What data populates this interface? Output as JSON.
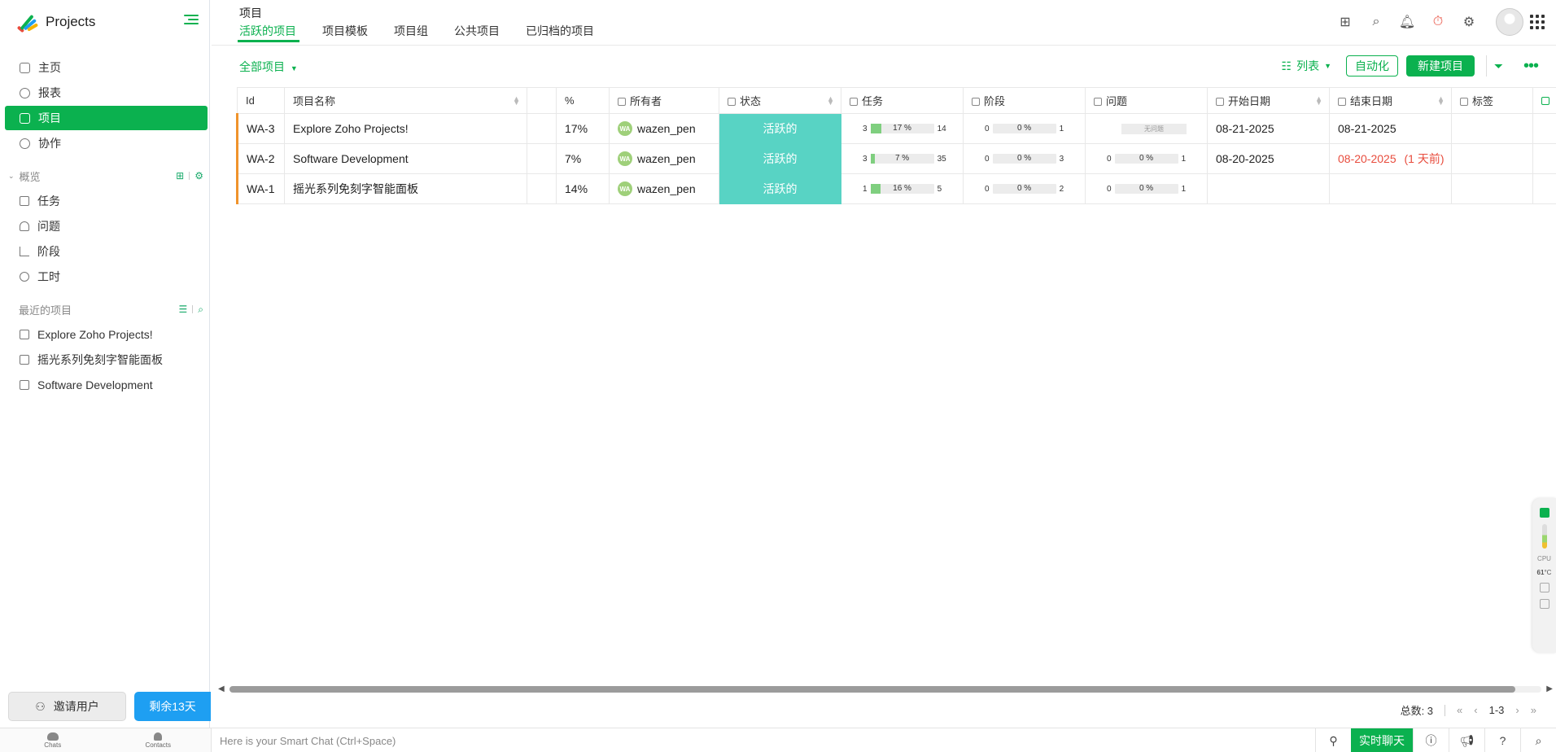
{
  "app": {
    "name": "Projects"
  },
  "sidebar": {
    "nav": [
      {
        "label": "主页",
        "icon": "home-icon"
      },
      {
        "label": "报表",
        "icon": "reports-icon"
      },
      {
        "label": "项目",
        "icon": "projects-icon",
        "active": true
      },
      {
        "label": "协作",
        "icon": "collaboration-icon"
      }
    ],
    "overview": {
      "title": "概览",
      "items": [
        {
          "label": "任务",
          "icon": "task-icon"
        },
        {
          "label": "问题",
          "icon": "issue-icon"
        },
        {
          "label": "阶段",
          "icon": "milestone-icon"
        },
        {
          "label": "工时",
          "icon": "timesheet-icon"
        }
      ]
    },
    "recent": {
      "title": "最近的项目",
      "items": [
        "Explore Zoho Projects!",
        "摇光系列免刻字智能面板",
        "Software Development"
      ]
    },
    "invite_label": "邀请用户",
    "trial_label": "剩余13天",
    "bottom": {
      "chats": "Chats",
      "contacts": "Contacts"
    }
  },
  "topbar": {
    "title": "项目",
    "tabs": [
      "活跃的项目",
      "项目模板",
      "项目组",
      "公共项目",
      "已归档的项目"
    ],
    "active_tab": 0
  },
  "toolbar": {
    "filter_label": "全部项目",
    "view_label": "列表",
    "automation_label": "自动化",
    "new_project_label": "新建项目"
  },
  "table": {
    "headers": {
      "id": "Id",
      "name": "项目名称",
      "percent": "%",
      "owner": "所有者",
      "status": "状态",
      "tasks": "任务",
      "milestones": "阶段",
      "issues": "问题",
      "start": "开始日期",
      "end": "结束日期",
      "tags": "标签"
    },
    "rows": [
      {
        "id": "WA-3",
        "name": "Explore Zoho Projects!",
        "percent": "17%",
        "owner": "wazen_pen",
        "owner_initials": "WA",
        "status": "活跃的",
        "tasks": {
          "open": "3",
          "pct_label": "17 %",
          "pct": 17,
          "closed": "14"
        },
        "milestones": {
          "open": "0",
          "pct_label": "0 %",
          "pct": 0,
          "closed": "1"
        },
        "issues": {
          "none": "无问题"
        },
        "start": "08-21-2025",
        "end": "08-21-2025",
        "end_note": ""
      },
      {
        "id": "WA-2",
        "name": "Software Development",
        "percent": "7%",
        "owner": "wazen_pen",
        "owner_initials": "WA",
        "status": "活跃的",
        "tasks": {
          "open": "3",
          "pct_label": "7 %",
          "pct": 7,
          "closed": "35"
        },
        "milestones": {
          "open": "0",
          "pct_label": "0 %",
          "pct": 0,
          "closed": "3"
        },
        "issues": {
          "open": "0",
          "pct_label": "0 %",
          "pct": 0,
          "closed": "1"
        },
        "start": "08-20-2025",
        "end": "08-20-2025",
        "end_note": "(1 天前)"
      },
      {
        "id": "WA-1",
        "name": "摇光系列免刻字智能面板",
        "percent": "14%",
        "owner": "wazen_pen",
        "owner_initials": "WA",
        "status": "活跃的",
        "tasks": {
          "open": "1",
          "pct_label": "16 %",
          "pct": 16,
          "closed": "5"
        },
        "milestones": {
          "open": "0",
          "pct_label": "0 %",
          "pct": 0,
          "closed": "2"
        },
        "issues": {
          "open": "0",
          "pct_label": "0 %",
          "pct": 0,
          "closed": "1"
        },
        "start": "",
        "end": "",
        "end_note": ""
      }
    ]
  },
  "pager": {
    "total_label": "总数: 3",
    "range": "1-3"
  },
  "bottombar": {
    "smart_chat_placeholder": "Here is your Smart Chat (Ctrl+Space)",
    "live_chat_label": "实时聊天"
  },
  "side_widget": {
    "cpu_label": "CPU",
    "temp": "61",
    "temp_unit": "°C"
  },
  "colors": {
    "accent": "#0bb14f",
    "status_active": "#58d3c4",
    "id_marker": "#f0932b",
    "overdue": "#e84c3d",
    "trial": "#1e9ff2"
  }
}
